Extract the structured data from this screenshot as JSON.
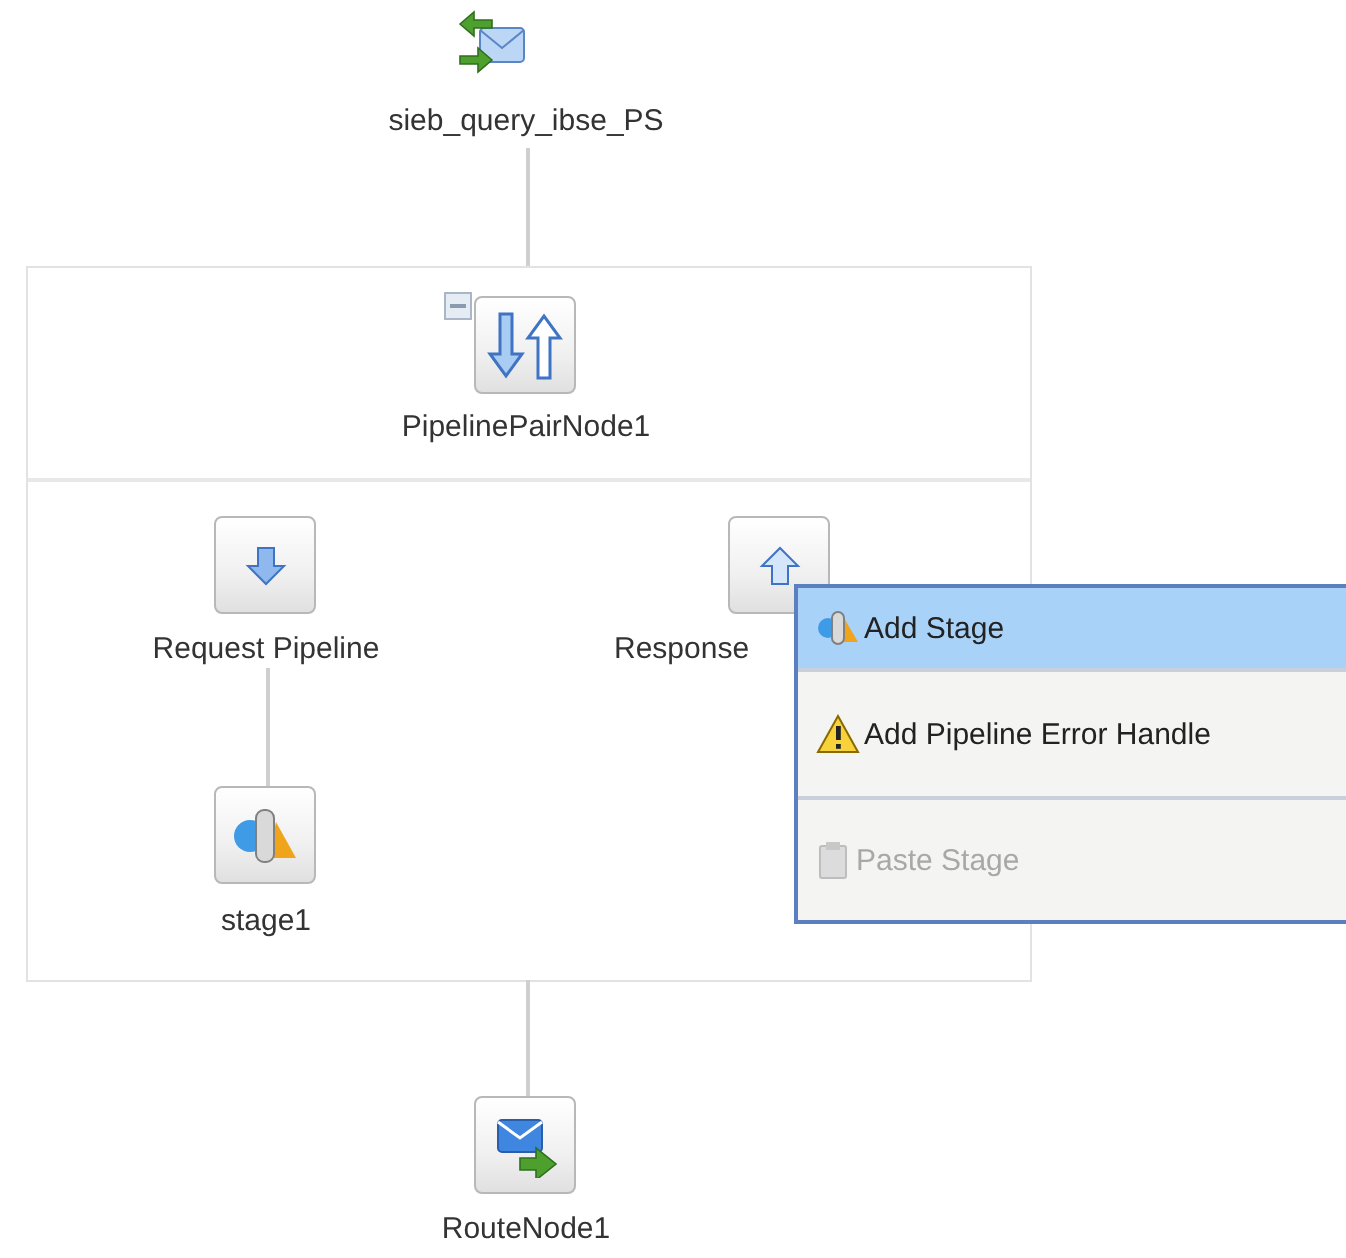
{
  "nodes": [
    {
      "kind": "service",
      "label": "sieb_query_ibse_PS"
    },
    {
      "kind": "pair",
      "label": "PipelinePairNode1",
      "expanded": true
    },
    {
      "kind": "request",
      "label": "Request Pipeline"
    },
    {
      "kind": "stage",
      "label": "stage1"
    },
    {
      "kind": "response",
      "label": "Response"
    },
    {
      "kind": "route",
      "label": "RouteNode1"
    }
  ],
  "context_menu": {
    "items": [
      {
        "kind": "stage",
        "label": "Add Stage",
        "selected": true,
        "disabled": false
      },
      {
        "kind": "error-handler",
        "label": "Add Pipeline Error Handle",
        "selected": false,
        "disabled": false
      },
      {
        "kind": "paste",
        "label": "Paste Stage",
        "selected": false,
        "disabled": true
      }
    ]
  }
}
